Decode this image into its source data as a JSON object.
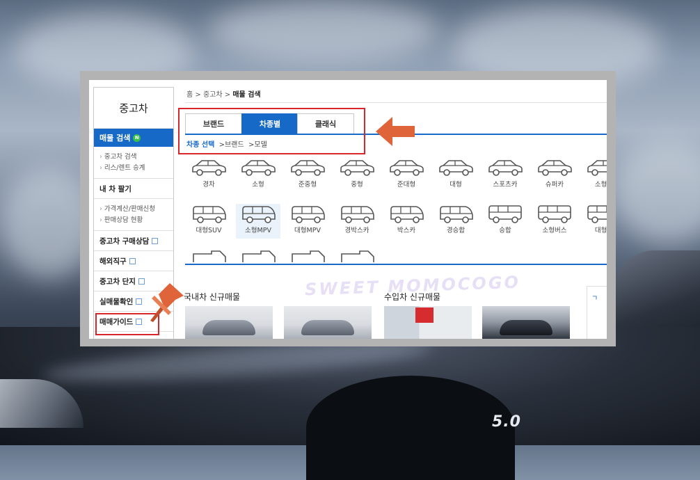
{
  "background": {
    "badge_text": "5.0"
  },
  "sidebar": {
    "title": "중고차",
    "active_item": "매물 검색",
    "active_badge": "N",
    "sub_items": [
      "중고차 검색",
      "리스/렌트 승계"
    ],
    "section": "내 차 팔기",
    "section_sub_items": [
      "가격계산/판매신청",
      "판매상담 현황"
    ],
    "links": [
      "중고차 구매상담",
      "해외직구",
      "중고차 단지",
      "실매물확인",
      "매매가이드"
    ]
  },
  "breadcrumb": {
    "home": "홈",
    "sep": ">",
    "level1": "중고차",
    "current": "매물 검색"
  },
  "tabs": [
    "브랜드",
    "차종별",
    "클래식"
  ],
  "subtabs": {
    "active": "차종 선택",
    "items": [
      "브랜드",
      "모델"
    ]
  },
  "car_types_row1": [
    "경차",
    "소형",
    "준중형",
    "중형",
    "준대형",
    "대형",
    "스포츠카",
    "슈퍼카",
    "소형트"
  ],
  "car_types_row2": [
    "대형SUV",
    "소형MPV",
    "대형MPV",
    "경박스카",
    "박스카",
    "경승합",
    "승합",
    "소형버스",
    "대형버"
  ],
  "watermark_text": "SWEET MOMOCOGO",
  "sections": {
    "domestic": "국내차 신규매물",
    "imported": "수입차 신규매물",
    "right_box_label": "ㄱ"
  },
  "colors": {
    "accent_blue": "#1669c7",
    "highlight_red": "#d8262b",
    "annotation_orange": "#e0643a"
  },
  "icons": [
    "arrow-left-icon",
    "push-pin-icon",
    "car-icon",
    "new-badge-icon",
    "link-square-icon"
  ]
}
